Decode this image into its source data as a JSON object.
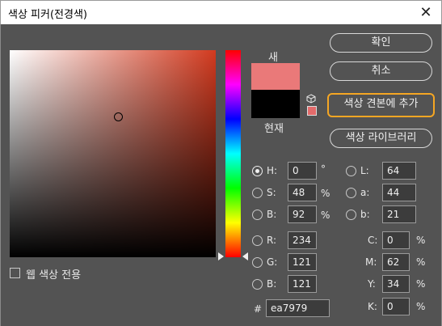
{
  "window": {
    "title": "색상 피커(전경색)"
  },
  "buttons": {
    "ok": "확인",
    "cancel": "취소",
    "add_to_swatches": "색상 견본에 추가",
    "color_libraries": "색상 라이브러리"
  },
  "swatch": {
    "new_label": "새",
    "current_label": "현재",
    "new_color": "#ea7979",
    "current_color": "#000000"
  },
  "only_web_colors": {
    "label": "웹 색상 전용",
    "checked": false
  },
  "hsb": {
    "h": {
      "label": "H:",
      "value": "0",
      "unit": "°",
      "selected": true
    },
    "s": {
      "label": "S:",
      "value": "48",
      "unit": "%",
      "selected": false
    },
    "b": {
      "label": "B:",
      "value": "92",
      "unit": "%",
      "selected": false
    }
  },
  "rgb": {
    "r": {
      "label": "R:",
      "value": "234"
    },
    "g": {
      "label": "G:",
      "value": "121"
    },
    "b": {
      "label": "B:",
      "value": "121"
    }
  },
  "lab": {
    "l": {
      "label": "L:",
      "value": "64"
    },
    "a": {
      "label": "a:",
      "value": "44"
    },
    "b": {
      "label": "b:",
      "value": "21"
    }
  },
  "cmyk": {
    "c": {
      "label": "C:",
      "value": "0",
      "unit": "%"
    },
    "m": {
      "label": "M:",
      "value": "62",
      "unit": "%"
    },
    "y": {
      "label": "Y:",
      "value": "34",
      "unit": "%"
    },
    "k": {
      "label": "K:",
      "value": "0",
      "unit": "%"
    }
  },
  "hex": {
    "label": "#",
    "value": "ea7979"
  },
  "colors": {
    "accent_highlight": "#f5a623",
    "field_hue": "#d23a1f"
  },
  "icons": {
    "close": "close-icon",
    "cube": "cube-icon"
  }
}
